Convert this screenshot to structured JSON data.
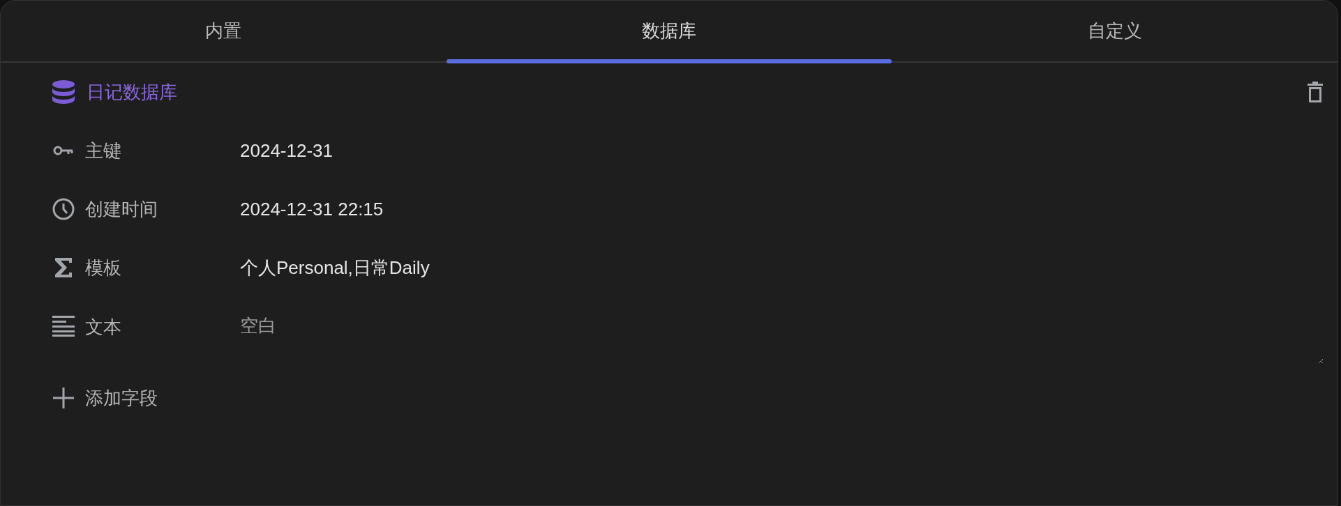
{
  "tabs": [
    {
      "label": "内置",
      "selected": false
    },
    {
      "label": "数据库",
      "selected": true
    },
    {
      "label": "自定义",
      "selected": false
    }
  ],
  "database": {
    "title": "日记数据库"
  },
  "fields": [
    {
      "kind": "key",
      "label": "主键",
      "value": "2024-12-31"
    },
    {
      "kind": "datetime",
      "label": "创建时间",
      "value": "2024-12-31 22:15"
    },
    {
      "kind": "formula",
      "label": "模板",
      "value": "个人Personal,日常Daily"
    },
    {
      "kind": "text",
      "label": "文本",
      "placeholder": "空白"
    }
  ],
  "add_field": {
    "label": "添加字段"
  }
}
